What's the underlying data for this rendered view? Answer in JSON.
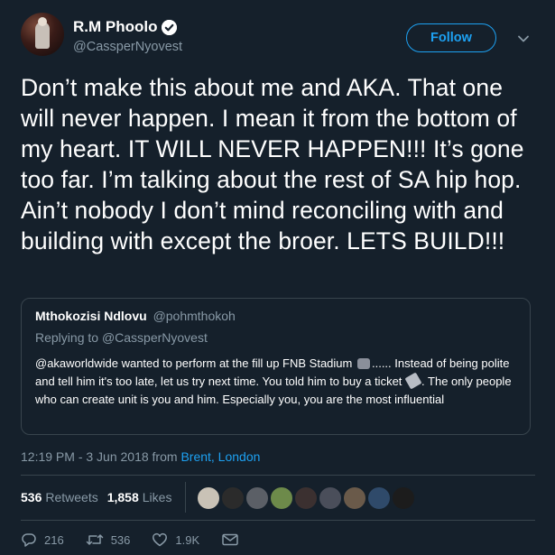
{
  "author": {
    "display_name": "R.M Phoolo",
    "handle": "@CassperNyovest",
    "verified": true
  },
  "follow_label": "Follow",
  "tweet_text": "Don’t make this about me and AKA. That one will never happen. I mean it from the bottom of my heart. IT WILL NEVER HAPPEN!!!  It’s gone too far. I’m talking about the rest of SA hip hop. Ain’t nobody I don’t mind reconciling with and building with except the broer. LETS BUILD!!!",
  "quoted": {
    "name": "Mthokozisi Ndlovu",
    "handle": "@pohmthokoh",
    "replying_prefix": "Replying to",
    "replying_to": "@CassperNyovest",
    "text_part1": "@akaworldwide wanted to perform at the fill up FNB Stadium",
    "text_part2": "...... Instead of being polite and tell him it's too late, let us try next time. You told him to buy a ticket",
    "text_part3": ". The only people who can create unit is you and him. Especially you, you are the most influential"
  },
  "meta": {
    "time_date": "12:19 PM - 3 Jun 2018 from",
    "place": "Brent, London"
  },
  "stats": {
    "retweets_count": "536",
    "retweets_label": "Retweets",
    "likes_count": "1,858",
    "likes_label": "Likes"
  },
  "liker_colors": [
    "#c9c2b6",
    "#2b2b2b",
    "#5b5f66",
    "#6d8a4a",
    "#3b3030",
    "#4a4e5a",
    "#6a5a4a",
    "#2f4a6a",
    "#1c1c1c"
  ],
  "actions": {
    "replies": "216",
    "retweets": "536",
    "likes": "1.9K"
  },
  "colors": {
    "background": "#15202b",
    "accent": "#1da1f2",
    "muted": "#8899a6",
    "border": "#38444d"
  }
}
